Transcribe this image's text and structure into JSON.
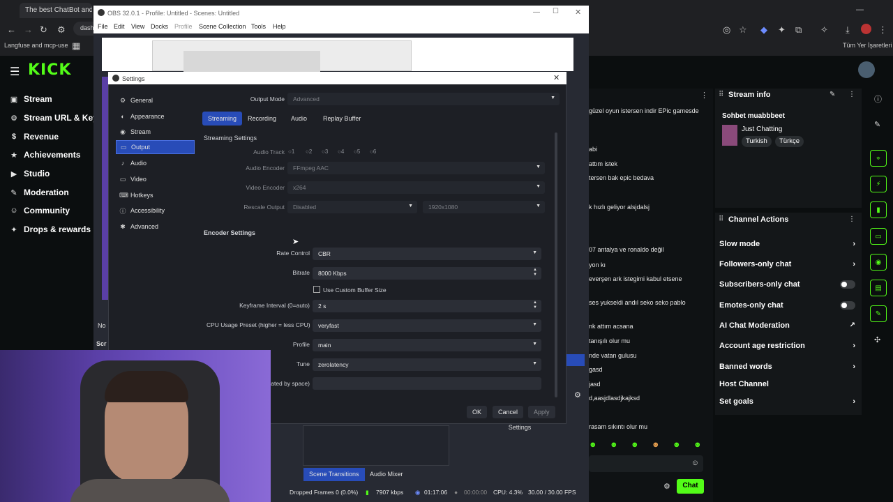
{
  "browser": {
    "tabs": [
      "The best ChatBot and W",
      "Langfuse and mcp-use"
    ],
    "partial_url": "dashbo",
    "bookmark_right": "Tüm Yer İşaretleri"
  },
  "kick": {
    "logo": "KICK",
    "nav": [
      {
        "label": "Stream",
        "icon": "▣"
      },
      {
        "label": "Stream URL & Key",
        "icon": "⚙"
      },
      {
        "label": "Revenue",
        "icon": "$"
      },
      {
        "label": "Achievements",
        "icon": "★"
      },
      {
        "label": "Studio",
        "icon": "▶"
      },
      {
        "label": "Moderation",
        "icon": "✎"
      },
      {
        "label": "Community",
        "icon": "☺"
      },
      {
        "label": "Drops & rewards",
        "icon": "✦"
      }
    ],
    "stream_info": {
      "title": "Stream info",
      "stream_title": "Sohbet muabbbeet",
      "category": "Just Chatting",
      "tags": [
        "Turkish",
        "Türkçe"
      ]
    },
    "channel_actions": {
      "title": "Channel Actions",
      "items": [
        {
          "label": "Slow mode",
          "control": "chevron"
        },
        {
          "label": "Followers-only chat",
          "control": "chevron"
        },
        {
          "label": "Subscribers-only chat",
          "control": "toggle"
        },
        {
          "label": "Emotes-only chat",
          "control": "toggle"
        },
        {
          "label": "AI Chat Moderation",
          "control": "link"
        },
        {
          "label": "Account age restriction",
          "control": "chevron"
        },
        {
          "label": "Banned words",
          "control": "chevron"
        },
        {
          "label": "Host Channel",
          "control": "none"
        },
        {
          "label": "Set goals",
          "control": "chevron"
        }
      ]
    },
    "chat_lines": [
      "güzel oyun istersen indir EPic gamesde",
      "abi",
      "attım istek",
      "tersen bak epic bedava",
      "k hızlı geliyor alsjdalsj",
      "07 antalya ve ronaldo değil",
      "yon kı",
      "everşen ark istegimi kabul etsene",
      "ses yukseldi andıl seko seko pablo",
      "nk attım acsana",
      "tanışılı olur mu",
      "nde vatan gulusu",
      "gasd",
      "jasd",
      "d,aasjdlasdjkajksd",
      "rasam sıkıntı olur mu"
    ],
    "chat_button": "Chat"
  },
  "obs": {
    "title": "OBS 32.0.1 - Profile: Untitled - Scenes: Untitled",
    "menu": [
      "File",
      "Edit",
      "View",
      "Docks",
      "Profile",
      "Scene Collection",
      "Tools",
      "Help"
    ],
    "bottom_tabs": [
      "Scene Transitions",
      "Audio Mixer"
    ],
    "settings_label": "Settings",
    "status": {
      "dropped": "Dropped Frames 0 (0.0%)",
      "bitrate": "7907 kbps",
      "live_time": "01:17:06",
      "rec_time": "00:00:00",
      "cpu": "CPU: 4.3%",
      "fps": "30.00 / 30.00 FPS"
    },
    "partial_left": [
      "No",
      "Scr"
    ]
  },
  "settings": {
    "title": "Settings",
    "nav": [
      {
        "label": "General",
        "icon": "⚙"
      },
      {
        "label": "Appearance",
        "icon": "◐"
      },
      {
        "label": "Stream",
        "icon": "◉"
      },
      {
        "label": "Output",
        "icon": "▭"
      },
      {
        "label": "Audio",
        "icon": "♪"
      },
      {
        "label": "Video",
        "icon": "▭"
      },
      {
        "label": "Hotkeys",
        "icon": "⌨"
      },
      {
        "label": "Accessibility",
        "icon": "ⓘ"
      },
      {
        "label": "Advanced",
        "icon": "✱"
      }
    ],
    "active_nav": "Output",
    "output_mode_label": "Output Mode",
    "output_mode_value": "Advanced",
    "tabs": [
      "Streaming",
      "Recording",
      "Audio",
      "Replay Buffer"
    ],
    "active_tab": "Streaming",
    "streaming_settings": {
      "header": "Streaming Settings",
      "audio_track_label": "Audio Track",
      "audio_tracks": [
        "1",
        "2",
        "3",
        "4",
        "5",
        "6"
      ],
      "audio_encoder_label": "Audio Encoder",
      "audio_encoder_value": "FFmpeg AAC",
      "video_encoder_label": "Video Encoder",
      "video_encoder_value": "x264",
      "rescale_label": "Rescale Output",
      "rescale_value": "Disabled",
      "rescale_res": "1920x1080"
    },
    "encoder_settings": {
      "header": "Encoder Settings",
      "rate_control_label": "Rate Control",
      "rate_control_value": "CBR",
      "bitrate_label": "Bitrate",
      "bitrate_value": "8000 Kbps",
      "custom_buffer_label": "Use Custom Buffer Size",
      "keyframe_label": "Keyframe Interval (0=auto)",
      "keyframe_value": "2 s",
      "cpu_preset_label": "CPU Usage Preset (higher = less CPU)",
      "cpu_preset_value": "veryfast",
      "profile_label": "Profile",
      "profile_value": "main",
      "tune_label": "Tune",
      "tune_value": "zerolatency",
      "x264_label_partial": "ated by space)",
      "x264_value": ""
    },
    "buttons": {
      "ok": "OK",
      "cancel": "Cancel",
      "apply": "Apply"
    }
  }
}
